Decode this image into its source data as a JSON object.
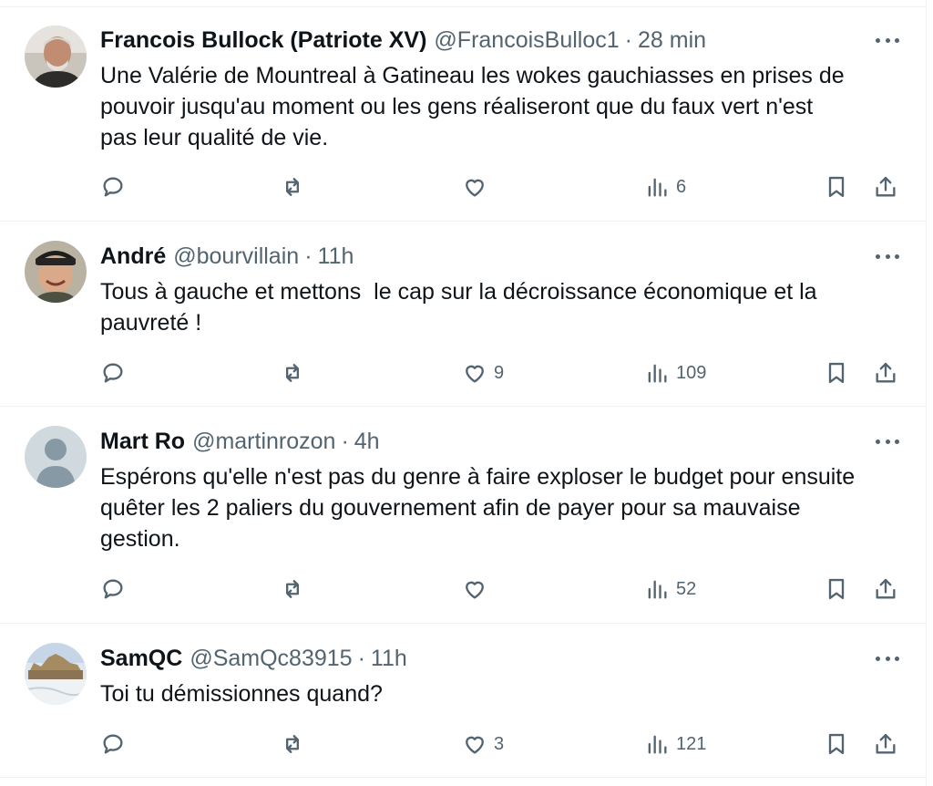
{
  "colors": {
    "text": "#0f1419",
    "muted": "#536471",
    "divider": "#eff3f4"
  },
  "icons": [
    "reply-icon",
    "retweet-icon",
    "like-icon",
    "views-icon",
    "bookmark-icon",
    "share-icon",
    "more-icon"
  ],
  "tweets": [
    {
      "name": "Francois Bullock (Patriote XV)",
      "handle": "@FrancoisBulloc1",
      "time": "28 min",
      "text": "Une Valérie de Mountreal à Gatineau les wokes gauchiasses en prises de\npouvoir jusqu'au moment ou les gens réaliseront que du faux vert n'est\npas leur qualité de vie.",
      "likes": "",
      "views": "6"
    },
    {
      "name": "André",
      "handle": "@bourvillain",
      "time": "11h",
      "text": "Tous à gauche et mettons  le cap sur la décroissance économique et la\npauvreté !",
      "likes": "9",
      "views": "109"
    },
    {
      "name": "Mart Ro",
      "handle": "@martinrozon",
      "time": "4h",
      "text": "Espérons qu'elle n'est pas du genre à faire exploser le budget pour ensuite\nquêter les 2 paliers du gouvernement afin de payer pour sa mauvaise\ngestion.",
      "likes": "",
      "views": "52"
    },
    {
      "name": "SamQC",
      "handle": "@SamQc83915",
      "time": "11h",
      "text": "Toi tu démissionnes quand?",
      "likes": "3",
      "views": "121"
    }
  ]
}
